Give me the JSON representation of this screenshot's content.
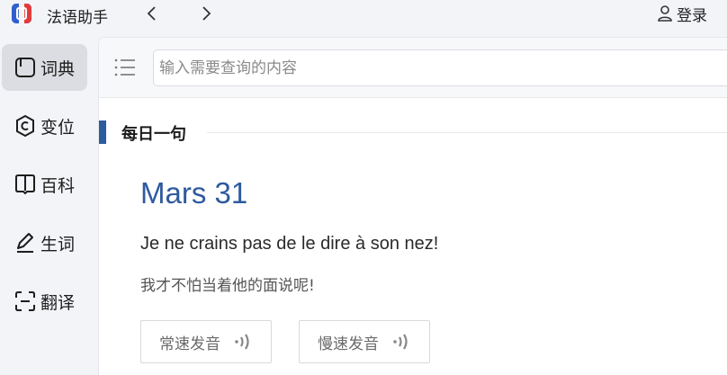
{
  "app": {
    "title": "法语助手"
  },
  "titlebar": {
    "back_glyph": "‹",
    "forward_glyph": "›",
    "login_label": "登录"
  },
  "sidebar": {
    "items": [
      {
        "label": "词典",
        "icon": "dictionary-icon",
        "active": true
      },
      {
        "label": "变位",
        "icon": "conjugation-icon",
        "active": false
      },
      {
        "label": "百科",
        "icon": "encyclopedia-icon",
        "active": false
      },
      {
        "label": "生词",
        "icon": "vocabulary-icon",
        "active": false
      },
      {
        "label": "翻译",
        "icon": "translate-icon",
        "active": false
      }
    ]
  },
  "search": {
    "placeholder": "输入需要查询的内容"
  },
  "daily": {
    "section_title": "每日一句",
    "date": "Mars 31",
    "sentence_fr": "Je ne crains pas de le dire à son nez!",
    "sentence_zh": "我才不怕当着他的面说呢!",
    "normal_speed_label": "常速发音",
    "slow_speed_label": "慢速发音"
  },
  "colors": {
    "accent": "#2e5a9e",
    "active_item_bg": "#dcdde2"
  }
}
